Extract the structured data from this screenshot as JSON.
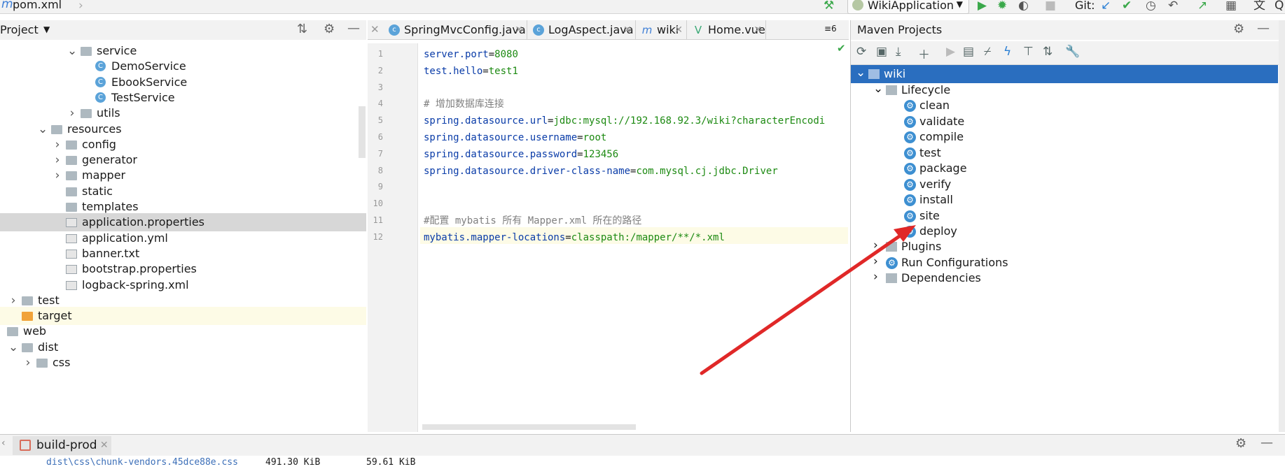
{
  "topbar": {
    "logo": "m",
    "breadcrumb": "pom.xml",
    "run_config": "WikiApplication",
    "git_label": "Git:"
  },
  "project_panel": {
    "title": "Project",
    "tree": [
      {
        "label": "service",
        "expanded": true,
        "icon": "folder-icon"
      },
      {
        "label": "DemoService",
        "icon": "class-icon"
      },
      {
        "label": "EbookService",
        "icon": "class-icon"
      },
      {
        "label": "TestService",
        "icon": "class-icon"
      },
      {
        "label": "utils",
        "expanded": false,
        "icon": "folder-icon"
      },
      {
        "label": "resources",
        "expanded": true,
        "icon": "folder-icon"
      },
      {
        "label": "config",
        "expanded": false,
        "icon": "folder-icon"
      },
      {
        "label": "generator",
        "expanded": false,
        "icon": "folder-icon"
      },
      {
        "label": "mapper",
        "expanded": false,
        "icon": "folder-icon"
      },
      {
        "label": "static",
        "icon": "folder-icon"
      },
      {
        "label": "templates",
        "icon": "folder-icon"
      },
      {
        "label": "application.properties",
        "icon": "properties-file-icon",
        "selected": true
      },
      {
        "label": "application.yml",
        "icon": "yml-file-icon"
      },
      {
        "label": "banner.txt",
        "icon": "text-file-icon"
      },
      {
        "label": "bootstrap.properties",
        "icon": "properties-file-icon"
      },
      {
        "label": "logback-spring.xml",
        "icon": "xml-file-icon"
      },
      {
        "label": "test",
        "expanded": false,
        "icon": "folder-icon"
      },
      {
        "label": "target",
        "icon": "folder-icon-orange",
        "highlighted": true
      },
      {
        "label": "web",
        "icon": "folder-icon"
      },
      {
        "label": "dist",
        "expanded": true,
        "icon": "folder-icon"
      },
      {
        "label": "css",
        "expanded": false,
        "icon": "folder-icon"
      }
    ]
  },
  "editor": {
    "tabs": [
      {
        "label": "SpringMvcConfig.java",
        "icon": "class-icon"
      },
      {
        "label": "LogAspect.java",
        "icon": "class-icon"
      },
      {
        "label": "wiki",
        "icon": "maven-icon"
      },
      {
        "label": "Home.vue",
        "icon": "vue-icon"
      }
    ],
    "tab_overflow": "≡6",
    "lines": [
      {
        "n": "1",
        "key": "server.port",
        "eq": "=",
        "val": "8080"
      },
      {
        "n": "2",
        "key": "test.hello",
        "eq": "=",
        "val": "test1"
      },
      {
        "n": "3",
        "key": "",
        "eq": "",
        "val": ""
      },
      {
        "n": "4",
        "comment": "# 增加数据库连接"
      },
      {
        "n": "5",
        "key": "spring.datasource.url",
        "eq": "=",
        "val": "jdbc:mysql://192.168.92.3/wiki?characterEncodi"
      },
      {
        "n": "6",
        "key": "spring.datasource.username",
        "eq": "=",
        "val": "root"
      },
      {
        "n": "7",
        "key": "spring.datasource.password",
        "eq": "=",
        "val": "123456"
      },
      {
        "n": "8",
        "key": "spring.datasource.driver-class-name",
        "eq": "=",
        "val": "com.mysql.cj.jdbc.Driver"
      },
      {
        "n": "9",
        "key": "",
        "eq": "",
        "val": ""
      },
      {
        "n": "10",
        "key": "",
        "eq": "",
        "val": ""
      },
      {
        "n": "11",
        "comment": "#配置 mybatis 所有 Mapper.xml 所在的路径"
      },
      {
        "n": "12",
        "key": "mybatis.mapper-locations",
        "eq": "=",
        "val": "classpath:/mapper/**/*.xml"
      }
    ]
  },
  "maven": {
    "title": "Maven Projects",
    "root": "wiki",
    "lifecycle_label": "Lifecycle",
    "goals": [
      "clean",
      "validate",
      "compile",
      "test",
      "package",
      "verify",
      "install",
      "site",
      "deploy"
    ],
    "sections": [
      "Plugins",
      "Run Configurations",
      "Dependencies"
    ],
    "arrow_color": "#e02828"
  },
  "bottom": {
    "tab_label": "build-prod",
    "console_path": "dist\\css\\chunk-vendors.45dce88e.css",
    "console_size": "491.30 KiB",
    "console_gzip": "59.61 KiB"
  }
}
